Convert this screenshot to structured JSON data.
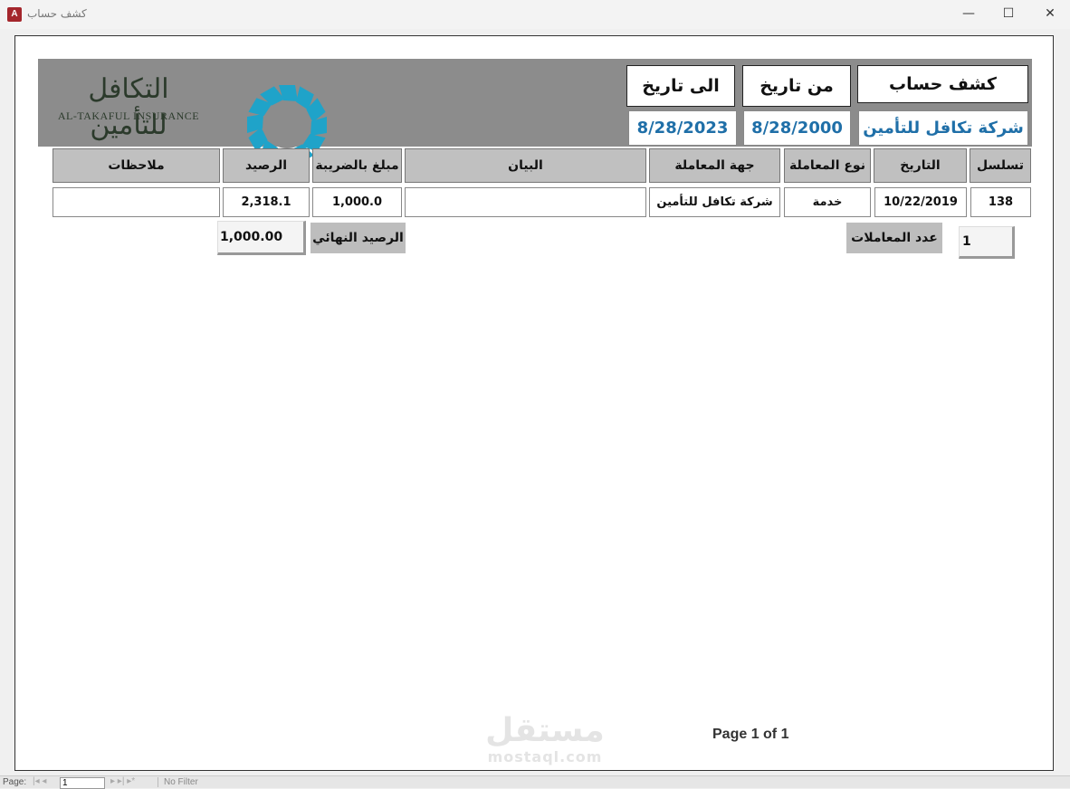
{
  "window": {
    "app_icon_letter": "A",
    "title": "كشف حساب",
    "minimize_glyph": "—",
    "maximize_glyph": "☐",
    "close_glyph": "✕"
  },
  "header": {
    "statement_label": "كشف حساب",
    "from_date_label": "من تاريخ",
    "to_date_label": "الى تاريخ",
    "party_name": "شركة تكافل للتأمين",
    "from_date": "8/28/2000",
    "to_date": "8/28/2023",
    "logo_arabic": "التكافل للتأمين",
    "logo_english": "AL-TAKAFUL INSURANCE",
    "logo_color": "#1fa3c9"
  },
  "table": {
    "columns": [
      "تسلسل",
      "التاريخ",
      "نوع المعاملة",
      "جهة المعاملة",
      "البيان",
      "مبلغ بالضريبة",
      "الرصيد",
      "ملاحظات"
    ],
    "rows": [
      {
        "serial": "138",
        "date": "10/22/2019",
        "type": "خدمة",
        "party": "شركة تكافل للتأمين",
        "description": "",
        "amount": "1,000.0",
        "balance": "2,318.1",
        "notes": ""
      }
    ]
  },
  "footer": {
    "count_label": "عدد المعاملات",
    "count_value": "1",
    "final_balance_label": "الرصيد النهائي",
    "final_balance_value": "1,000.00",
    "page_text": "Page 1 of 1"
  },
  "watermark": {
    "arabic": "مستقل",
    "latin": "mostaql.com"
  },
  "navbar": {
    "page_label": "Page:",
    "first_prev": "|◂ ◂",
    "page_input": "1",
    "next_last": "▸ ▸| ▸*",
    "filter_label": "No Filter"
  }
}
